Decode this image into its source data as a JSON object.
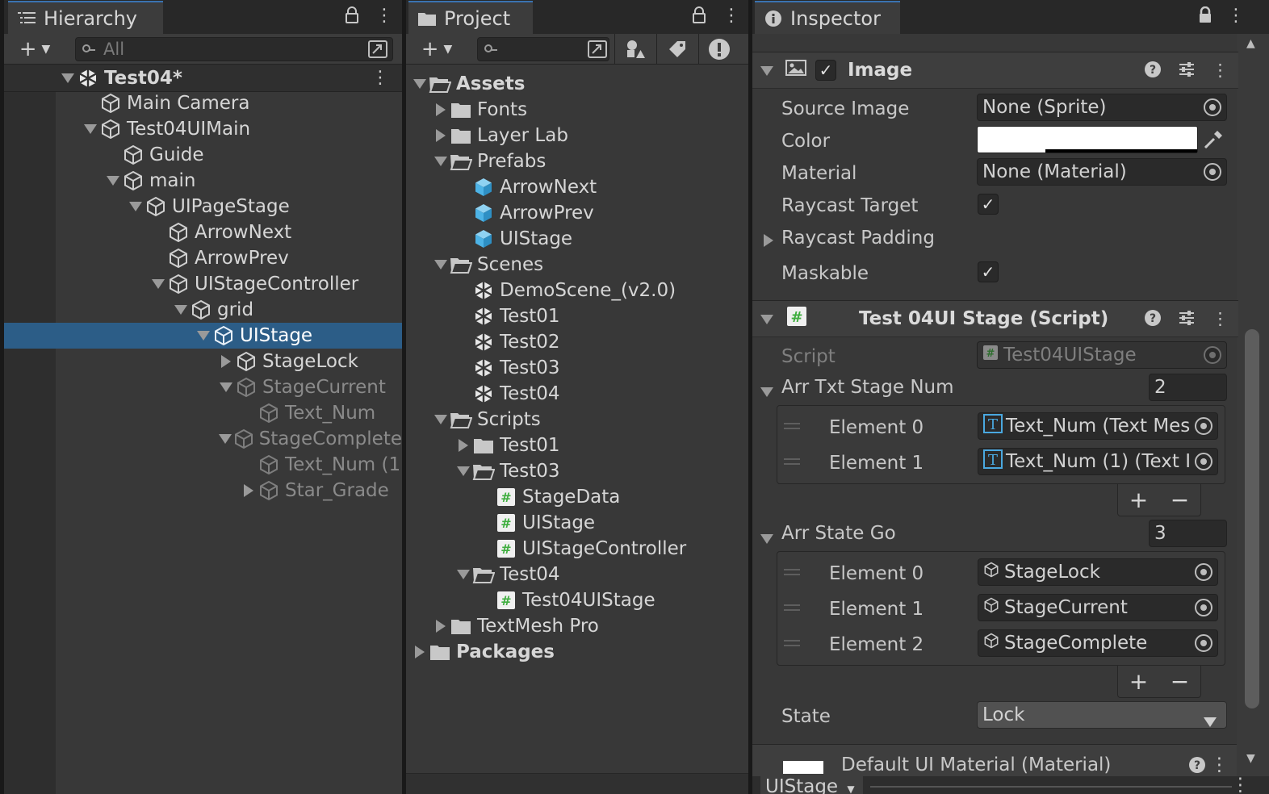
{
  "hierarchy": {
    "tab_title": "Hierarchy",
    "search_placeholder": "All",
    "scene": {
      "name": "Test04*"
    },
    "items": [
      {
        "label": "Main Camera"
      },
      {
        "label": "Test04UIMain"
      },
      {
        "label": "Guide"
      },
      {
        "label": "main"
      },
      {
        "label": "UIPageStage"
      },
      {
        "label": "ArrowNext"
      },
      {
        "label": "ArrowPrev"
      },
      {
        "label": "UIStageController"
      },
      {
        "label": "grid"
      },
      {
        "label": "UIStage"
      },
      {
        "label": "StageLock"
      },
      {
        "label": "StageCurrent"
      },
      {
        "label": "Text_Num"
      },
      {
        "label": "StageComplete"
      },
      {
        "label": "Text_Num (1"
      },
      {
        "label": "Star_Grade"
      }
    ]
  },
  "project": {
    "tab_title": "Project",
    "items": [
      {
        "label": "Assets"
      },
      {
        "label": "Fonts"
      },
      {
        "label": "Layer Lab"
      },
      {
        "label": "Prefabs"
      },
      {
        "label": "ArrowNext"
      },
      {
        "label": "ArrowPrev"
      },
      {
        "label": "UIStage"
      },
      {
        "label": "Scenes"
      },
      {
        "label": "DemoScene_(v2.0)"
      },
      {
        "label": "Test01"
      },
      {
        "label": "Test02"
      },
      {
        "label": "Test03"
      },
      {
        "label": "Test04"
      },
      {
        "label": "Scripts"
      },
      {
        "label": "Test01"
      },
      {
        "label": "Test03"
      },
      {
        "label": "StageData"
      },
      {
        "label": "UIStage"
      },
      {
        "label": "UIStageController"
      },
      {
        "label": "Test04"
      },
      {
        "label": "Test04UIStage"
      },
      {
        "label": "TextMesh Pro"
      },
      {
        "label": "Packages"
      }
    ]
  },
  "inspector": {
    "tab_title": "Inspector",
    "image_component": {
      "title": "Image",
      "enabled": true,
      "source_image_label": "Source Image",
      "source_image_value": "None (Sprite)",
      "color_label": "Color",
      "color_value": "#ffffff",
      "material_label": "Material",
      "material_value": "None (Material)",
      "raycast_target_label": "Raycast Target",
      "raycast_target_checked": "✓",
      "raycast_padding_label": "Raycast Padding",
      "maskable_label": "Maskable",
      "maskable_checked": "✓"
    },
    "script_component": {
      "title": "Test 04UI Stage (Script)",
      "script_label": "Script",
      "script_value": "Test04UIStage",
      "arr_txt_label": "Arr Txt Stage Num",
      "arr_txt_size": "2",
      "arr_txt_elements": [
        {
          "label": "Element 0",
          "value": "Text_Num (Text Mes"
        },
        {
          "label": "Element 1",
          "value": "Text_Num (1) (Text I"
        }
      ],
      "arr_state_label": "Arr State Go",
      "arr_state_size": "3",
      "arr_state_elements": [
        {
          "label": "Element 0",
          "value": "StageLock"
        },
        {
          "label": "Element 1",
          "value": "StageCurrent"
        },
        {
          "label": "Element 2",
          "value": "StageComplete"
        }
      ],
      "state_label": "State",
      "state_value": "Lock"
    },
    "material_footer": {
      "title": "Default UI Material (Material)"
    },
    "preview_dropdown": "UIStage"
  },
  "colors": {
    "selection": "#2c5d87",
    "panel_bg": "#383838",
    "script_icon": "#3fae3f",
    "prefab_icon": "#4db3e6"
  }
}
